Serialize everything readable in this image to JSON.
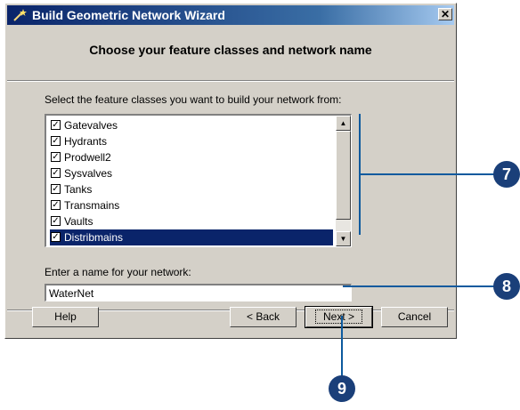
{
  "window": {
    "title": "Build Geometric Network Wizard",
    "close_glyph": "✕"
  },
  "wizard": {
    "heading": "Choose your feature classes and network name",
    "list_label": "Select the feature classes you want to build your network from:",
    "name_label": "Enter a name for your network:",
    "name_value": "WaterNet"
  },
  "feature_classes": [
    {
      "label": "Gatevalves",
      "checked": true,
      "selected": false
    },
    {
      "label": "Hydrants",
      "checked": true,
      "selected": false
    },
    {
      "label": "Prodwell2",
      "checked": true,
      "selected": false
    },
    {
      "label": "Sysvalves",
      "checked": true,
      "selected": false
    },
    {
      "label": "Tanks",
      "checked": true,
      "selected": false
    },
    {
      "label": "Transmains",
      "checked": true,
      "selected": false
    },
    {
      "label": "Vaults",
      "checked": true,
      "selected": false
    },
    {
      "label": "Distribmains",
      "checked": true,
      "selected": true
    }
  ],
  "checkbox_glyph": "✓",
  "scroll": {
    "up_glyph": "▲",
    "down_glyph": "▼"
  },
  "buttons": {
    "help": "Help",
    "back": "< Back",
    "next": "Next >",
    "cancel": "Cancel"
  },
  "callouts": {
    "c7": "7",
    "c8": "8",
    "c9": "9"
  },
  "colors": {
    "title_bar": "#0a246a",
    "selection": "#0a246a",
    "callout": "#1a3f79",
    "callout_line": "#0d5a9e"
  }
}
